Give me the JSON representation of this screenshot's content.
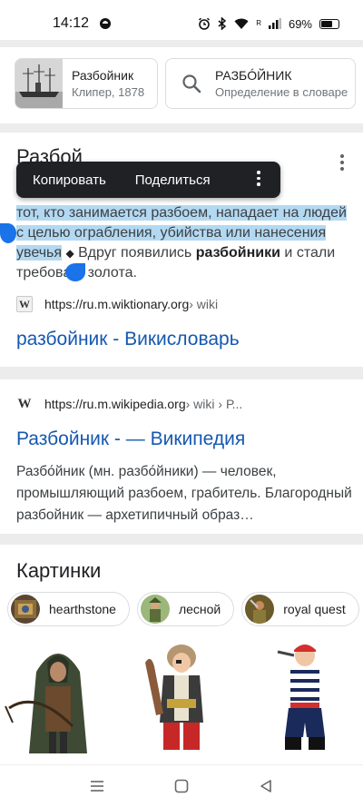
{
  "status_bar": {
    "time": "14:12",
    "battery": "69%",
    "signal": "R",
    "battery_level": 0.69,
    "icons": [
      "alarm-icon",
      "bluetooth-icon",
      "wifi-icon",
      "signal-icon",
      "battery-icon"
    ]
  },
  "kp_cards": [
    {
      "title": "Разбойник",
      "subtitle": "Клипер, 1878",
      "icon": "ship-image"
    },
    {
      "title": "РАЗБÓЙНИК",
      "subtitle": "Определение в словаре",
      "icon": "search-icon"
    }
  ],
  "result1": {
    "heading": "Разбой",
    "selection_popup": {
      "copy": "Копировать",
      "share": "Поделиться"
    },
    "snippet": {
      "line1": "тот, кто занимается разбоем, нападает на людей",
      "line2": "с целью ограбления, убийства или нанесения",
      "line3_hl": "увечья",
      "diamond": "◆",
      "line3_a": " Вдруг появились ",
      "line3_bold": "разбойники",
      "line3_b": " и стали",
      "line4_a": "требова",
      "line4_b": " золота."
    },
    "source": {
      "url": "https://ru.m.wiktionary.org",
      "path": " › wiki",
      "favicon": "W"
    },
    "link": "разбойник - Викисловарь"
  },
  "result2": {
    "source": {
      "url": "https://ru.m.wikipedia.org",
      "path": " › wiki › Р...",
      "favicon": "W"
    },
    "link": "Разбойник - — Википедия",
    "text": "Разбо́йник (мн. разбо́йники) — человек, промышляющий разбоем, грабитель. Благородный разбойник — архетипичный образ…"
  },
  "images": {
    "title": "Картинки",
    "chips": [
      "hearthstone",
      "лесной",
      "royal quest"
    ]
  },
  "colors": {
    "link": "#1558b0",
    "selection": "#b3d9f2",
    "handle": "#1a73e8",
    "popup": "#202124"
  },
  "nav": [
    "recents-button",
    "home-button",
    "back-button"
  ]
}
